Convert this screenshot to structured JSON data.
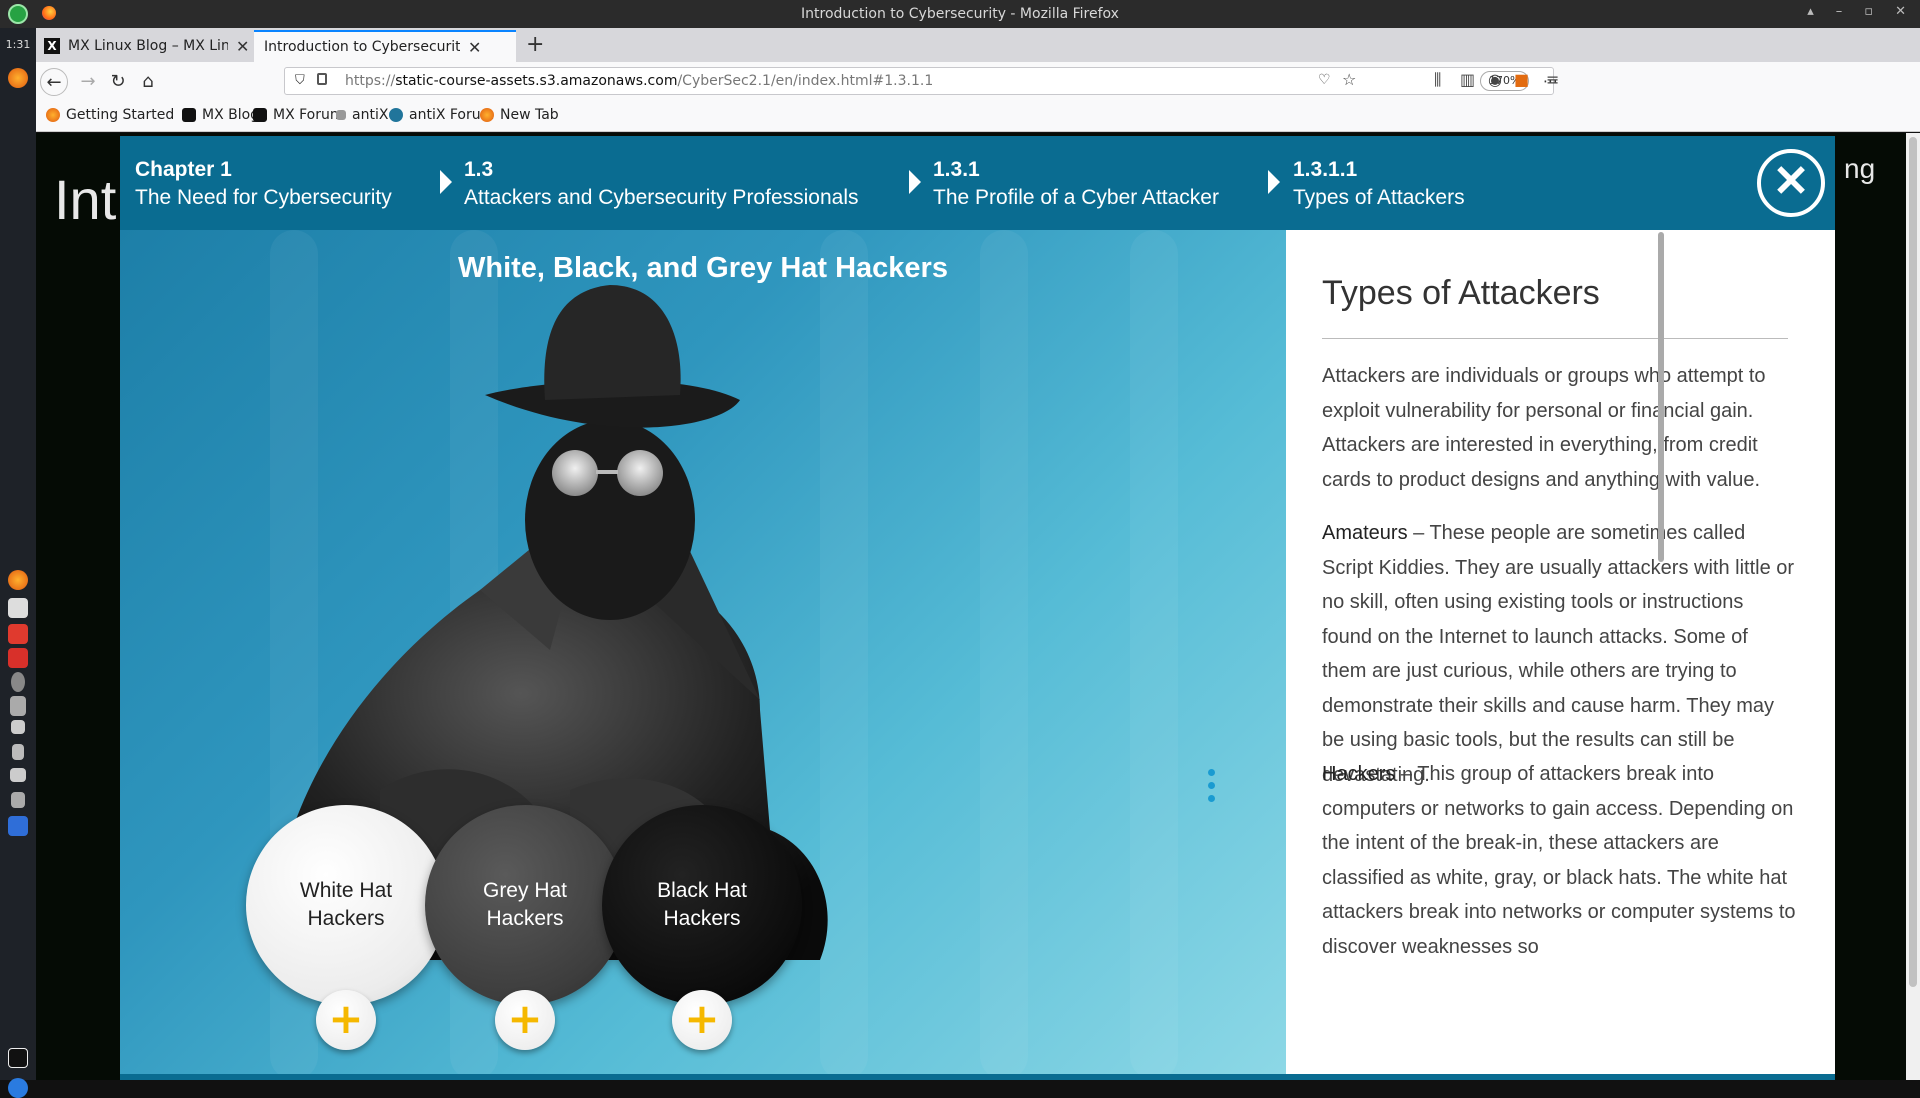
{
  "window": {
    "title": "Introduction to Cybersecurity - Mozilla Firefox",
    "controls": [
      "▴",
      "–",
      "▫",
      "✕"
    ]
  },
  "dock": {
    "clock": "1:31"
  },
  "tabs": [
    {
      "label": "MX Linux Blog – MX Linu",
      "favicon": "X"
    },
    {
      "label": "Introduction to Cybersecurit",
      "favicon": ""
    }
  ],
  "navbar": {
    "url_prefix": "https://",
    "url_host": "static-course-assets.s3.amazonaws.com",
    "url_path": "/CyberSec2.1/en/index.html#1.3.1.1",
    "zoom": "170%"
  },
  "bookmarks": [
    {
      "label": "Getting Started",
      "icon": "firefox-icon"
    },
    {
      "label": "MX Blog",
      "icon": "mx-icon"
    },
    {
      "label": "MX Forum",
      "icon": "mx-icon"
    },
    {
      "label": "antiX",
      "icon": "antix-icon"
    },
    {
      "label": "antiX Forum",
      "icon": "wordpress-icon"
    },
    {
      "label": "New Tab",
      "icon": "firefox-icon"
    }
  ],
  "background_page": {
    "title_fragment": "Intr",
    "right_fragment": "ng"
  },
  "modal": {
    "breadcrumbs": [
      {
        "num": "Chapter 1",
        "label": "The Need for Cybersecurity"
      },
      {
        "num": "1.3",
        "label": "Attackers and Cybersecurity Professionals"
      },
      {
        "num": "1.3.1",
        "label": "The Profile of a Cyber Attacker"
      },
      {
        "num": "1.3.1.1",
        "label": "Types of Attackers"
      }
    ],
    "close_label": "✕",
    "scene_title": "White, Black, and Grey Hat Hackers",
    "hacker_buttons": [
      {
        "line1": "White Hat",
        "line2": "Hackers"
      },
      {
        "line1": "Grey Hat",
        "line2": "Hackers"
      },
      {
        "line1": "Black Hat",
        "line2": "Hackers"
      }
    ],
    "plus_label": "+",
    "panel": {
      "heading": "Types of Attackers",
      "intro": "Attackers are individuals or groups who attempt to exploit vulnerability for personal or financial gain. Attackers are interested in everything, from credit cards to product designs and anything with value.",
      "amateurs_term": "Amateurs",
      "amateurs_text": " – These people are sometimes called Script Kiddies. They are usually attackers with little or no skill, often using existing tools or instructions found on the Internet to launch attacks. Some of them are just curious, while others are trying to demonstrate their skills and cause harm. They may be using basic tools, but the results can still be devastating.",
      "hackers_term": "Hackers",
      "hackers_text": " – This group of attackers break into computers or networks to gain access. Depending on the intent of the break-in, these attackers are classified as white, gray, or black hats. The white hat attackers break into networks or computer systems to discover weaknesses so"
    }
  },
  "colors": {
    "header_blue": "#0a6c91",
    "plus_yellow": "#f5b800",
    "accent_blue": "#1a9bd1"
  }
}
